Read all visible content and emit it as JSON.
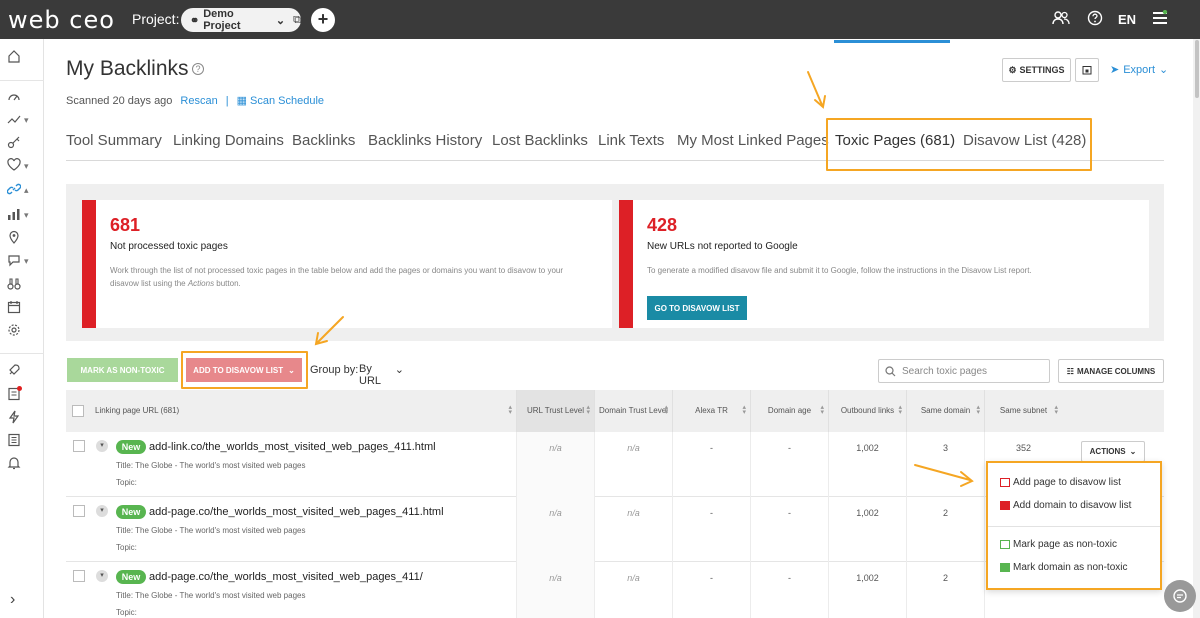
{
  "topbar": {
    "logo": "web ceo",
    "project_label": "Project:",
    "project_name": "Demo Project",
    "lang": "EN"
  },
  "header": {
    "title": "My Backlinks",
    "scanned": "Scanned 20 days ago",
    "rescan": "Rescan",
    "scan_schedule": "Scan Schedule",
    "settings": "SETTINGS",
    "export": "Export"
  },
  "tabs": [
    {
      "label": "Tool Summary"
    },
    {
      "label": "Linking Domains"
    },
    {
      "label": "Backlinks"
    },
    {
      "label": "Backlinks History"
    },
    {
      "label": "Lost Backlinks"
    },
    {
      "label": "Link Texts"
    },
    {
      "label": "My Most Linked Pages"
    },
    {
      "label": "Toxic Pages (681)"
    },
    {
      "label": "Disavow List (428)"
    }
  ],
  "stats": {
    "toxic": {
      "number": "681",
      "label": "Not processed toxic pages",
      "desc1": "Work through the list of not processed toxic pages in the table below and add the pages or domains you want to disavow to your",
      "desc2_pre": "disavow list using the ",
      "desc2_em": "Actions",
      "desc2_post": " button."
    },
    "disavow": {
      "number": "428",
      "label": "New URLs not reported to Google",
      "desc": "To generate a modified disavow file and submit it to Google, follow the instructions in the Disavow List report.",
      "button": "GO TO DISAVOW LIST"
    }
  },
  "toolbar": {
    "mark_non_toxic": "MARK AS NON-TOXIC",
    "add_to_disavow": "ADD TO DISAVOW LIST",
    "group_by_label": "Group by:",
    "group_by_value": "By URL",
    "search_placeholder": "Search toxic pages",
    "manage_columns": "MANAGE COLUMNS"
  },
  "table": {
    "columns": [
      "Linking page URL (681)",
      "URL Trust Level",
      "Domain Trust Level",
      "Alexa TR",
      "Domain age",
      "Outbound links",
      "Same domain",
      "Same subnet"
    ],
    "rows": [
      {
        "badge": "New",
        "url": "add-link.co/the_worlds_most_visited_web_pages_411.html",
        "title": "Title: The Globe - The world's most visited web pages",
        "topic": "Topic:",
        "url_trust": "n/a",
        "domain_trust": "n/a",
        "alexa": "-",
        "age": "-",
        "outbound": "1,002",
        "same_domain": "3",
        "same_subnet": "352",
        "actions": "ACTIONS"
      },
      {
        "badge": "New",
        "url": "add-page.co/the_worlds_most_visited_web_pages_411.html",
        "title": "Title: The Globe - The world's most visited web pages",
        "topic": "Topic:",
        "url_trust": "n/a",
        "domain_trust": "n/a",
        "alexa": "-",
        "age": "-",
        "outbound": "1,002",
        "same_domain": "2",
        "same_subnet": "",
        "actions": ""
      },
      {
        "badge": "New",
        "url": "add-page.co/the_worlds_most_visited_web_pages_411/",
        "title": "Title: The Globe - The world's most visited web pages",
        "topic": "Topic:",
        "url_trust": "n/a",
        "domain_trust": "n/a",
        "alexa": "-",
        "age": "-",
        "outbound": "1,002",
        "same_domain": "2",
        "same_subnet": "",
        "actions": ""
      }
    ]
  },
  "actions_menu": [
    {
      "label": "Add page to disavow list"
    },
    {
      "label": "Add domain to disavow list"
    },
    {
      "label": "Mark page as non-toxic"
    },
    {
      "label": "Mark domain as non-toxic"
    }
  ],
  "colors": {
    "accent_blue": "#2b8fd6",
    "toxic_red": "#dd2026",
    "highlight_orange": "#f5a623",
    "new_green": "#58b550",
    "teal_button": "#1a8ba5"
  }
}
